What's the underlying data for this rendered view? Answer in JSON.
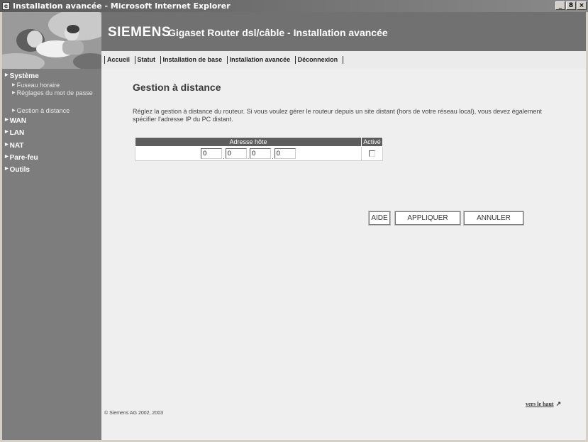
{
  "window": {
    "title": "Installation avancée - Microsoft Internet Explorer",
    "controls": [
      "_",
      "8",
      "×"
    ]
  },
  "header": {
    "brand": "SIEMENS",
    "product": "Gigaset Router dsl/câble  -  Installation avancée"
  },
  "topnav": {
    "items": [
      "Accueil",
      "Statut",
      "Installation de base",
      "Installation avancée",
      "Déconnexion"
    ]
  },
  "sidebar": {
    "sections": [
      {
        "label": "Système"
      },
      {
        "label": "WAN"
      },
      {
        "label": "LAN"
      },
      {
        "label": "NAT"
      },
      {
        "label": "Pare-feu"
      },
      {
        "label": "Outils"
      }
    ],
    "system_items": [
      {
        "label": "Fuseau horaire"
      },
      {
        "label": "Réglages du mot de passe"
      },
      {
        "label": "Gestion à distance"
      }
    ]
  },
  "main": {
    "title": "Gestion à distance",
    "description": "Réglez la gestion à distance du routeur. Si vous voulez gérer le routeur depuis un site distant (hors de votre réseau local), vous devez également spécifier l'adresse IP du PC distant.",
    "table": {
      "headers": [
        "Adresse hôte",
        "Activé"
      ],
      "ip": [
        "0",
        "0",
        "0",
        "0"
      ],
      "enabled": false
    },
    "buttons": {
      "help": "AIDE",
      "apply": "APPLIQUER",
      "cancel": "ANNULER"
    },
    "copyright": "© Siemens AG 2002, 2003",
    "to_top": "vers le haut"
  },
  "colors": {
    "brandbar": "#717171",
    "sidebar": "#7d7d7d",
    "table_header": "#5d5d5d",
    "page_bg": "#efefef"
  },
  "icons": {
    "browser": "ie-icon",
    "bullet": "triangle-right-icon",
    "to_top": "arrow-up-icon"
  }
}
